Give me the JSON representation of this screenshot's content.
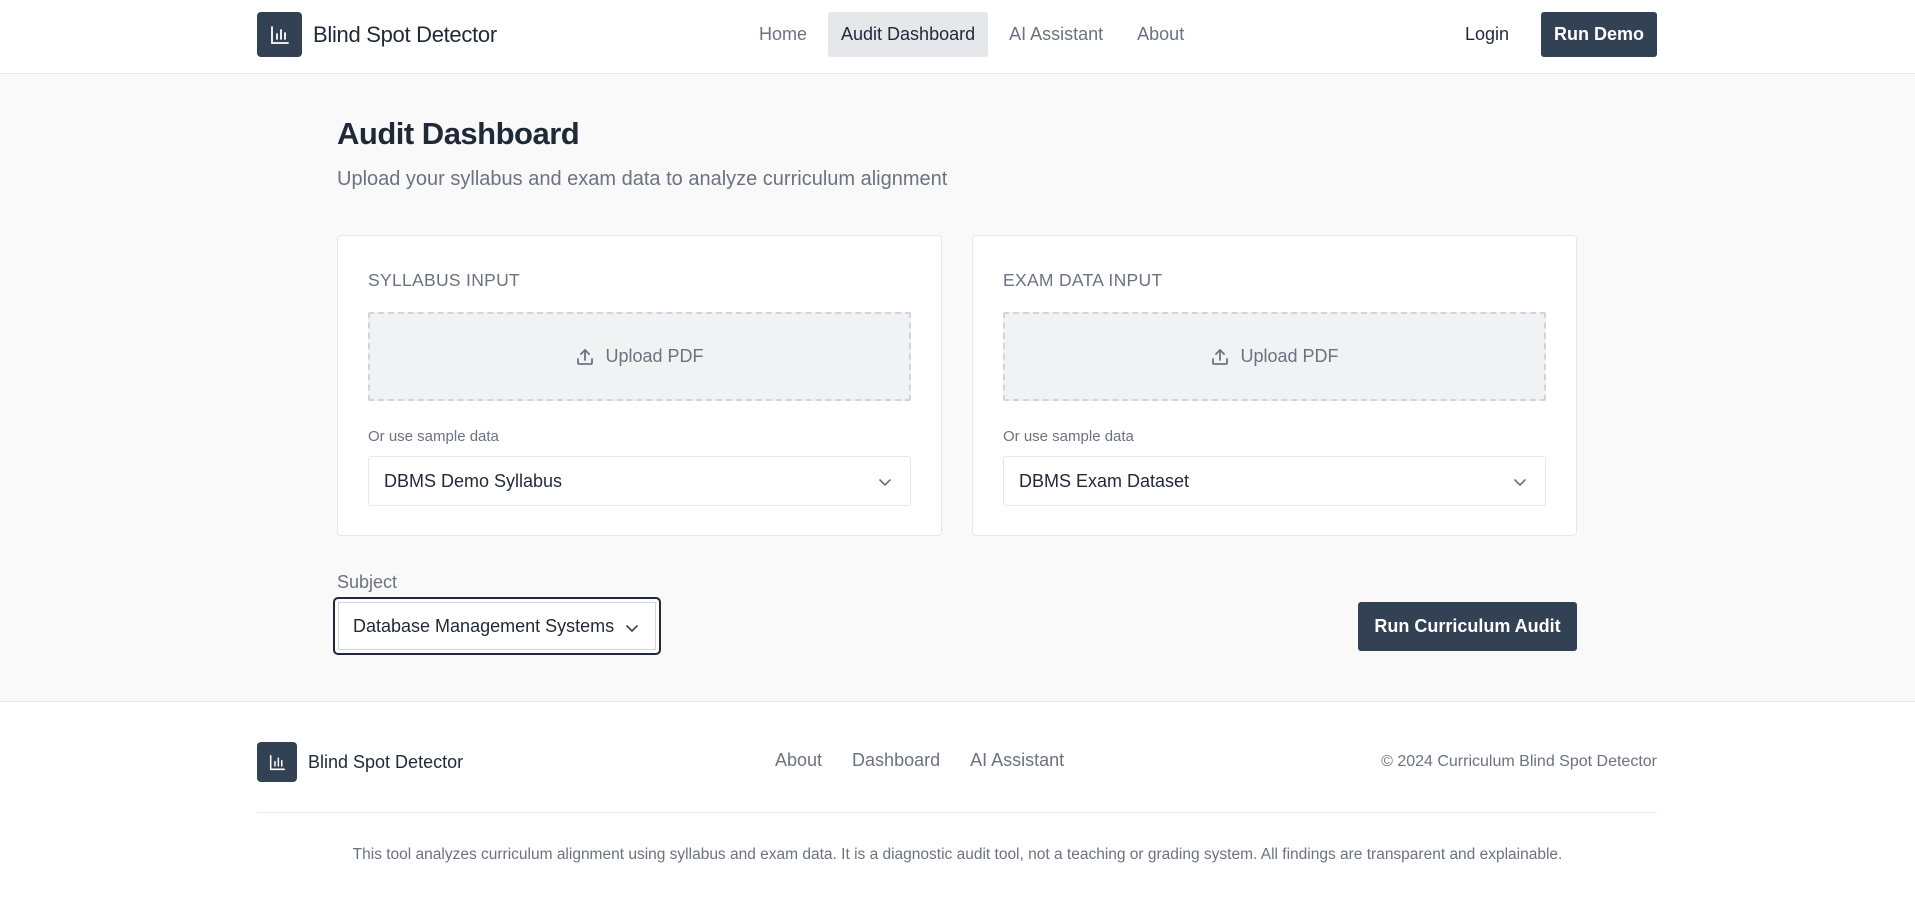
{
  "header": {
    "brand": "Blind Spot Detector",
    "nav": [
      "Home",
      "Audit Dashboard",
      "AI Assistant",
      "About"
    ],
    "active_nav": "Audit Dashboard",
    "login": "Login",
    "run_demo": "Run Demo"
  },
  "main": {
    "title": "Audit Dashboard",
    "subtitle": "Upload your syllabus and exam data to analyze curriculum alignment",
    "syllabus": {
      "title": "SYLLABUS INPUT",
      "upload": "Upload PDF",
      "sample_label": "Or use sample data",
      "selected": "DBMS Demo Syllabus"
    },
    "exam": {
      "title": "EXAM DATA INPUT",
      "upload": "Upload PDF",
      "sample_label": "Or use sample data",
      "selected": "DBMS Exam Dataset"
    },
    "subject_label": "Subject",
    "subject_selected": "Database Management Systems",
    "run_audit": "Run Curriculum Audit"
  },
  "footer": {
    "brand": "Blind Spot Detector",
    "links": [
      "About",
      "Dashboard",
      "AI Assistant"
    ],
    "copyright": "© 2024 Curriculum Blind Spot Detector",
    "disclaimer": "This tool analyzes curriculum alignment using syllabus and exam data. It is a diagnostic audit tool, not a teaching or grading system. All findings are transparent and explainable."
  },
  "icons": {
    "logo": "bar-chart-icon",
    "upload": "upload-icon",
    "dropdown": "chevron-down-icon"
  },
  "colors": {
    "primary": "#334155",
    "page_bg": "#f9f9f9",
    "muted_text": "#6b7280"
  }
}
